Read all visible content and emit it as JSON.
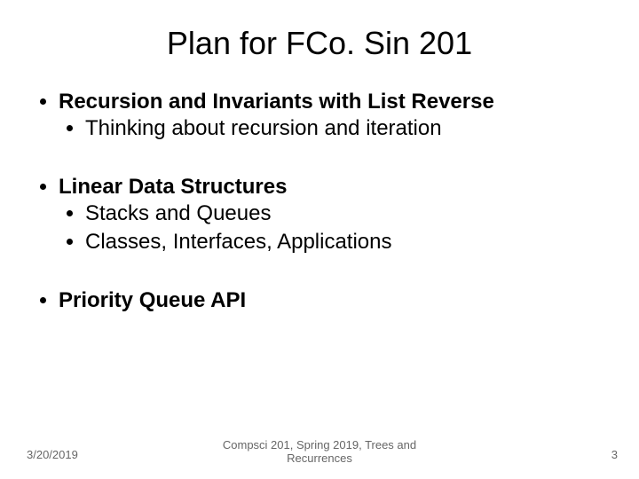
{
  "title": "Plan for FCo. Sin 201",
  "sections": [
    {
      "heading": "Recursion and Invariants with List Reverse",
      "items": [
        "Thinking about recursion and iteration"
      ]
    },
    {
      "heading": "Linear Data Structures",
      "items": [
        "Stacks and Queues",
        "Classes, Interfaces, Applications"
      ]
    },
    {
      "heading": "Priority Queue API",
      "items": []
    }
  ],
  "footer": {
    "date": "3/20/2019",
    "center": "Compsci 201, Spring 2019,  Trees and\nRecurrences",
    "page": "3"
  }
}
